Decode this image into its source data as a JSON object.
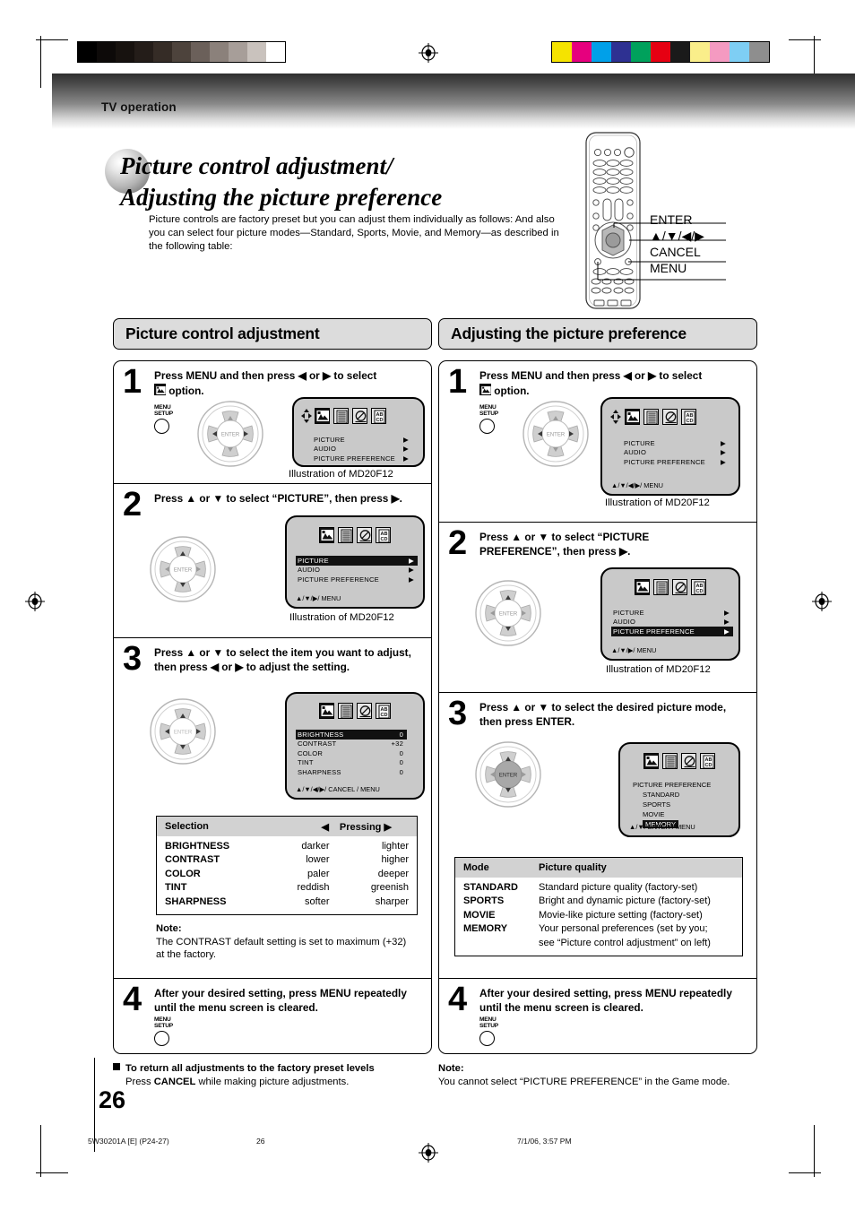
{
  "header": {
    "running_head": "TV operation"
  },
  "title": {
    "line1": "Picture control adjustment/",
    "line2": "Adjusting the picture preference",
    "intro": "Picture controls are factory preset but you can adjust them individually as follows: And also you can select four picture modes—Standard, Sports, Movie, and Memory—as described in the following table:"
  },
  "remote_callouts": [
    {
      "label": "ENTER"
    },
    {
      "label": "▲/▼/◀/▶"
    },
    {
      "label": "CANCEL"
    },
    {
      "label": "MENU"
    }
  ],
  "left_section": {
    "heading": "Picture control adjustment",
    "steps": [
      {
        "number": "1",
        "text": "Press MENU and then press ◀ or ▶ to select  option.",
        "caption": "Illustration of MD20F12"
      },
      {
        "number": "2",
        "text": "Press ▲ or ▼ to select “PICTURE”, then press ▶.",
        "caption": "Illustration of MD20F12"
      },
      {
        "number": "3",
        "text": "Press ▲ or ▼ to select the item you want to adjust, then press ◀ or ▶ to adjust the setting."
      },
      {
        "number": "4",
        "text": "After your desired setting, press MENU repeatedly until the menu screen is cleared."
      }
    ],
    "osd1": {
      "rows": [
        {
          "label": "PICTURE",
          "arrow": "▶",
          "highlight": false
        },
        {
          "label": "AUDIO",
          "arrow": "▶",
          "highlight": false
        },
        {
          "label": "PICTURE  PREFERENCE",
          "arrow": "▶",
          "highlight": false
        }
      ],
      "hint": ""
    },
    "osd2": {
      "rows": [
        {
          "label": "PICTURE",
          "arrow": "▶",
          "highlight": true
        },
        {
          "label": "AUDIO",
          "arrow": "▶",
          "highlight": false
        },
        {
          "label": "PICTURE  PREFERENCE",
          "arrow": "▶",
          "highlight": false
        }
      ],
      "hint": "▲/▼/▶/ MENU"
    },
    "osd3": {
      "rows": [
        {
          "label": "BRIGHTNESS",
          "value": "0",
          "highlight": true
        },
        {
          "label": "CONTRAST",
          "value": "+32",
          "highlight": false
        },
        {
          "label": "COLOR",
          "value": "0",
          "highlight": false
        },
        {
          "label": "TINT",
          "value": "0",
          "highlight": false
        },
        {
          "label": "SHARPNESS",
          "value": "0",
          "highlight": false
        }
      ],
      "hint": "▲/▼/◀/▶/ CANCEL / MENU"
    },
    "selection_table": {
      "header": {
        "selection": "Selection",
        "left_arrow": "◀",
        "pressing": "Pressing",
        "right_arrow": "▶"
      },
      "rows": [
        {
          "selection": "BRIGHTNESS",
          "left": "darker",
          "right": "lighter"
        },
        {
          "selection": "CONTRAST",
          "left": "lower",
          "right": "higher"
        },
        {
          "selection": "COLOR",
          "left": "paler",
          "right": "deeper"
        },
        {
          "selection": "TINT",
          "left": "reddish",
          "right": "greenish"
        },
        {
          "selection": "SHARPNESS",
          "left": "softer",
          "right": "sharper"
        }
      ]
    },
    "note": {
      "title": "Note:",
      "body": "The CONTRAST default setting is set to maximum (+32) at the factory."
    },
    "reset_note": {
      "heading": "To return all adjustments to the factory preset levels",
      "body_pre": "Press ",
      "body_bold": "CANCEL",
      "body_post": " while making picture adjustments."
    }
  },
  "right_section": {
    "heading": "Adjusting the picture preference",
    "steps": [
      {
        "number": "1",
        "text": "Press MENU and then press ◀ or ▶ to select  option.",
        "caption": "Illustration of MD20F12"
      },
      {
        "number": "2",
        "text": "Press ▲ or ▼ to select “PICTURE PREFERENCE”, then press ▶.",
        "caption": "Illustration of MD20F12"
      },
      {
        "number": "3",
        "text": "Press ▲ or ▼ to select the desired picture mode, then press ENTER."
      },
      {
        "number": "4",
        "text": "After your desired setting, press MENU repeatedly until the menu screen is cleared."
      }
    ],
    "osd1": {
      "rows": [
        {
          "label": "PICTURE",
          "arrow": "▶",
          "highlight": false
        },
        {
          "label": "AUDIO",
          "arrow": "▶",
          "highlight": false
        },
        {
          "label": "PICTURE  PREFERENCE",
          "arrow": "▶",
          "highlight": false
        }
      ],
      "hint": "▲/▼/◀/▶/ MENU"
    },
    "osd2": {
      "rows": [
        {
          "label": "PICTURE",
          "arrow": "▶",
          "highlight": false
        },
        {
          "label": "AUDIO",
          "arrow": "▶",
          "highlight": false
        },
        {
          "label": "PICTURE  PREFERENCE",
          "arrow": "▶",
          "highlight": true
        }
      ],
      "hint": "▲/▼/▶/ MENU"
    },
    "osd3": {
      "title": "PICTURE PREFERENCE",
      "items": [
        {
          "label": "STANDARD",
          "highlight": false
        },
        {
          "label": "SPORTS",
          "highlight": false
        },
        {
          "label": "MOVIE",
          "highlight": false
        },
        {
          "label": "MEMORY",
          "highlight": true
        }
      ],
      "hint": "▲/▼/ ENTER / MENU"
    },
    "mode_table": {
      "header": {
        "mode": "Mode",
        "quality": "Picture quality"
      },
      "rows": [
        {
          "mode": "STANDARD",
          "quality": "Standard picture quality (factory-set)"
        },
        {
          "mode": "SPORTS",
          "quality": "Bright and dynamic picture (factory-set)"
        },
        {
          "mode": "MOVIE",
          "quality": "Movie-like picture setting (factory-set)"
        },
        {
          "mode": "MEMORY",
          "quality": "Your personal preferences (set by you;"
        },
        {
          "mode": "",
          "quality": "see “Picture control adjustment” on left)"
        }
      ]
    },
    "note": {
      "title": "Note:",
      "body": "You cannot select “PICTURE PREFERENCE” in the Game mode."
    }
  },
  "page": {
    "number": "26"
  },
  "footer": {
    "job": "5W30201A [E] (P24-27)",
    "folio": "26",
    "timestamp": "7/1/06, 3:57 PM"
  },
  "calibration": {
    "grayscale": [
      "#000000",
      "#0d0a09",
      "#17120f",
      "#241d19",
      "#352c26",
      "#4d433c",
      "#6b605a",
      "#8b817b",
      "#a79e99",
      "#c9c2bd",
      "#ffffff"
    ],
    "colors": [
      "#f5e300",
      "#e6007e",
      "#00a0e9",
      "#2e3192",
      "#00a15c",
      "#e60012",
      "#1a1a1a",
      "#faee8a",
      "#f49ac1",
      "#7ecef4",
      "#8e8e8e"
    ]
  }
}
